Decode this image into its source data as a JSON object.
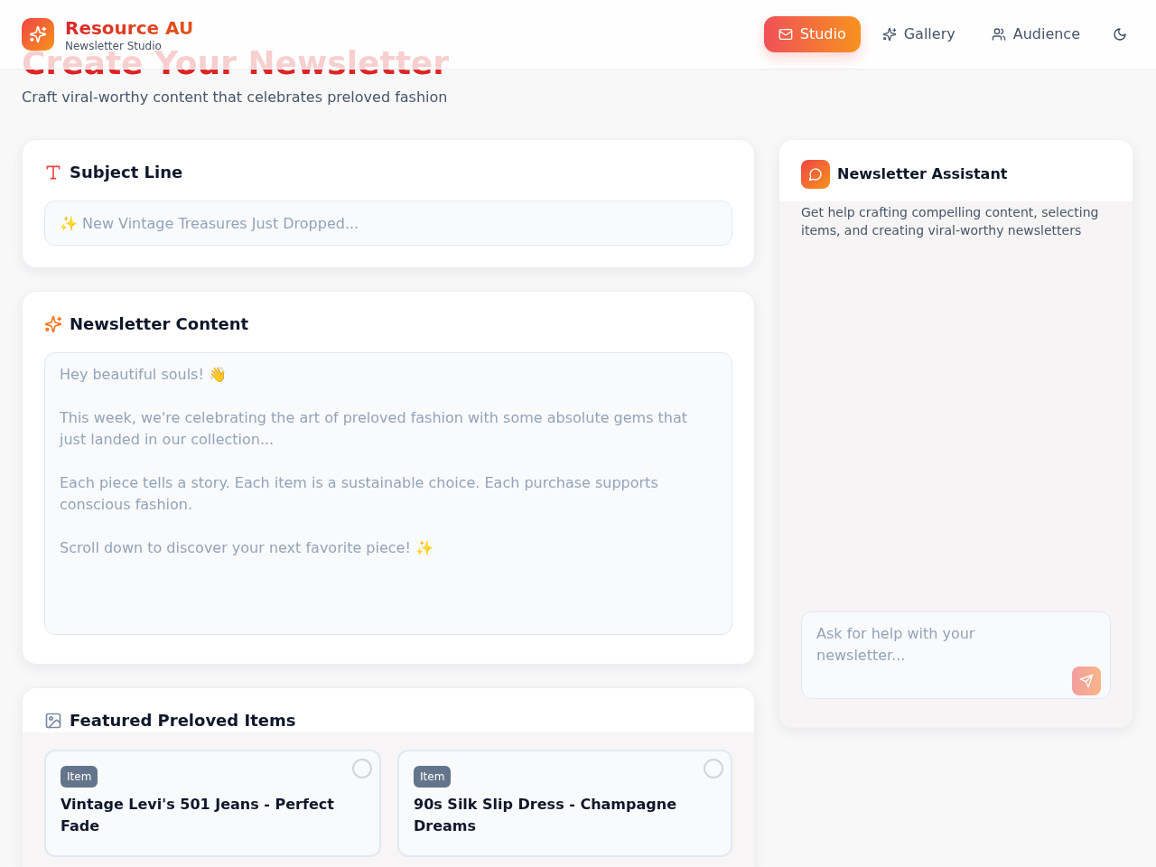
{
  "header": {
    "brand": {
      "name": "Resource AU",
      "tagline": "Newsletter Studio"
    },
    "nav": [
      {
        "label": "Studio",
        "selected": true
      },
      {
        "label": "Gallery",
        "selected": false
      },
      {
        "label": "Audience",
        "selected": false
      }
    ]
  },
  "page": {
    "title": "Create Your Newsletter",
    "subtitle": "Craft viral-worthy content that celebrates preloved fashion"
  },
  "subject_line": {
    "title": "Subject Line",
    "placeholder": "✨ New Vintage Treasures Just Dropped..."
  },
  "newsletter_content": {
    "title": "Newsletter Content",
    "placeholder": "Hey beautiful souls! 👋\n\nThis week, we're celebrating the art of preloved fashion with some absolute gems that just landed in our collection...\n\nEach piece tells a story. Each item is a sustainable choice. Each purchase supports conscious fashion.\n\nScroll down to discover your next favorite piece! ✨"
  },
  "featured_items": {
    "title": "Featured Preloved Items",
    "items": [
      {
        "badge": "Item",
        "name": "Vintage Levi's 501 Jeans - Perfect Fade",
        "selected": false
      },
      {
        "badge": "Item",
        "name": "90s Silk Slip Dress - Champagne Dreams",
        "selected": false
      }
    ]
  },
  "assistant": {
    "title": "Newsletter Assistant",
    "description": "Get help crafting compelling content, selecting items, and creating viral-worthy newsletters",
    "input": {
      "placeholder": "Ask for help with your newsletter..."
    },
    "send_button": {
      "disabled": true
    }
  }
}
